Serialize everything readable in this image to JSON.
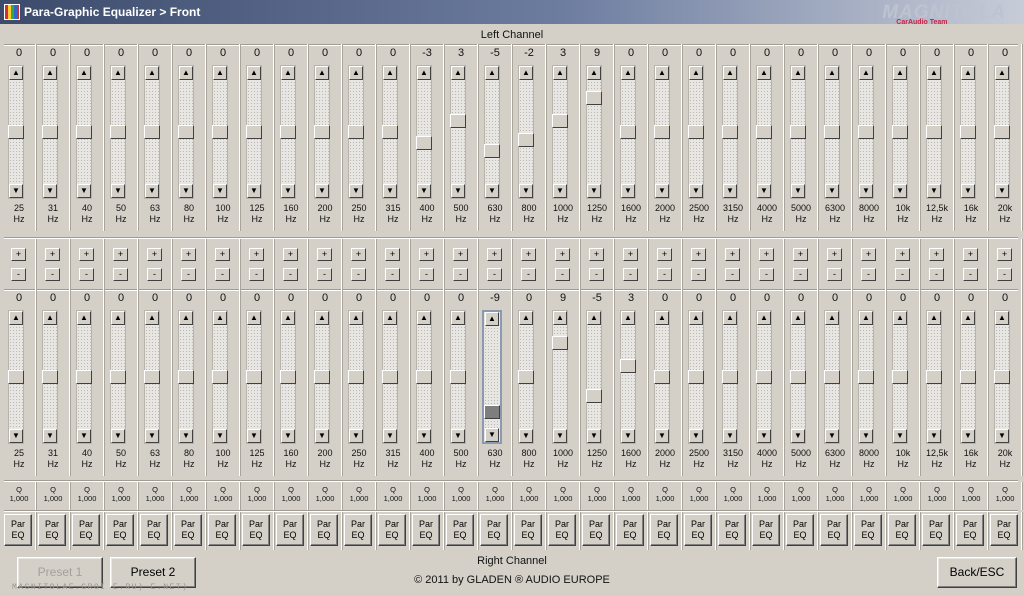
{
  "window": {
    "title": "Para-Graphic Equalizer > Front",
    "icon": "equalizer-app-icon"
  },
  "logo": {
    "main": "MAGNITOLA",
    "sub": "CarAudio Team"
  },
  "left_channel": {
    "label": "Left Channel",
    "bands": [
      {
        "value": "0",
        "freq": "25",
        "unit": "Hz"
      },
      {
        "value": "0",
        "freq": "31",
        "unit": "Hz"
      },
      {
        "value": "0",
        "freq": "40",
        "unit": "Hz"
      },
      {
        "value": "0",
        "freq": "50",
        "unit": "Hz"
      },
      {
        "value": "0",
        "freq": "63",
        "unit": "Hz"
      },
      {
        "value": "0",
        "freq": "80",
        "unit": "Hz"
      },
      {
        "value": "0",
        "freq": "100",
        "unit": "Hz"
      },
      {
        "value": "0",
        "freq": "125",
        "unit": "Hz"
      },
      {
        "value": "0",
        "freq": "160",
        "unit": "Hz"
      },
      {
        "value": "0",
        "freq": "200",
        "unit": "Hz"
      },
      {
        "value": "0",
        "freq": "250",
        "unit": "Hz"
      },
      {
        "value": "0",
        "freq": "315",
        "unit": "Hz"
      },
      {
        "value": "-3",
        "freq": "400",
        "unit": "Hz"
      },
      {
        "value": "3",
        "freq": "500",
        "unit": "Hz"
      },
      {
        "value": "-5",
        "freq": "630",
        "unit": "Hz"
      },
      {
        "value": "-2",
        "freq": "800",
        "unit": "Hz"
      },
      {
        "value": "3",
        "freq": "1000",
        "unit": "Hz"
      },
      {
        "value": "9",
        "freq": "1250",
        "unit": "Hz"
      },
      {
        "value": "0",
        "freq": "1600",
        "unit": "Hz"
      },
      {
        "value": "0",
        "freq": "2000",
        "unit": "Hz"
      },
      {
        "value": "0",
        "freq": "2500",
        "unit": "Hz"
      },
      {
        "value": "0",
        "freq": "3150",
        "unit": "Hz"
      },
      {
        "value": "0",
        "freq": "4000",
        "unit": "Hz"
      },
      {
        "value": "0",
        "freq": "5000",
        "unit": "Hz"
      },
      {
        "value": "0",
        "freq": "6300",
        "unit": "Hz"
      },
      {
        "value": "0",
        "freq": "8000",
        "unit": "Hz"
      },
      {
        "value": "0",
        "freq": "10k",
        "unit": "Hz"
      },
      {
        "value": "0",
        "freq": "12,5k",
        "unit": "Hz"
      },
      {
        "value": "0",
        "freq": "16k",
        "unit": "Hz"
      },
      {
        "value": "0",
        "freq": "20k",
        "unit": "Hz"
      }
    ]
  },
  "right_channel": {
    "label": "Right Channel",
    "focused_band": 14,
    "bands": [
      {
        "value": "0",
        "freq": "25",
        "unit": "Hz",
        "q_label": "Q",
        "q": "1,000"
      },
      {
        "value": "0",
        "freq": "31",
        "unit": "Hz",
        "q_label": "Q",
        "q": "1,000"
      },
      {
        "value": "0",
        "freq": "40",
        "unit": "Hz",
        "q_label": "Q",
        "q": "1,000"
      },
      {
        "value": "0",
        "freq": "50",
        "unit": "Hz",
        "q_label": "Q",
        "q": "1,000"
      },
      {
        "value": "0",
        "freq": "63",
        "unit": "Hz",
        "q_label": "Q",
        "q": "1,000"
      },
      {
        "value": "0",
        "freq": "80",
        "unit": "Hz",
        "q_label": "Q",
        "q": "1,000"
      },
      {
        "value": "0",
        "freq": "100",
        "unit": "Hz",
        "q_label": "Q",
        "q": "1,000"
      },
      {
        "value": "0",
        "freq": "125",
        "unit": "Hz",
        "q_label": "Q",
        "q": "1,000"
      },
      {
        "value": "0",
        "freq": "160",
        "unit": "Hz",
        "q_label": "Q",
        "q": "1,000"
      },
      {
        "value": "0",
        "freq": "200",
        "unit": "Hz",
        "q_label": "Q",
        "q": "1,000"
      },
      {
        "value": "0",
        "freq": "250",
        "unit": "Hz",
        "q_label": "Q",
        "q": "1,000"
      },
      {
        "value": "0",
        "freq": "315",
        "unit": "Hz",
        "q_label": "Q",
        "q": "1,000"
      },
      {
        "value": "0",
        "freq": "400",
        "unit": "Hz",
        "q_label": "Q",
        "q": "1,000"
      },
      {
        "value": "0",
        "freq": "500",
        "unit": "Hz",
        "q_label": "Q",
        "q": "1,000"
      },
      {
        "value": "-9",
        "freq": "630",
        "unit": "Hz",
        "q_label": "Q",
        "q": "1,000"
      },
      {
        "value": "0",
        "freq": "800",
        "unit": "Hz",
        "q_label": "Q",
        "q": "1,000"
      },
      {
        "value": "9",
        "freq": "1000",
        "unit": "Hz",
        "q_label": "Q",
        "q": "1,000"
      },
      {
        "value": "-5",
        "freq": "1250",
        "unit": "Hz",
        "q_label": "Q",
        "q": "1,000"
      },
      {
        "value": "3",
        "freq": "1600",
        "unit": "Hz",
        "q_label": "Q",
        "q": "1,000"
      },
      {
        "value": "0",
        "freq": "2000",
        "unit": "Hz",
        "q_label": "Q",
        "q": "1,000"
      },
      {
        "value": "0",
        "freq": "2500",
        "unit": "Hz",
        "q_label": "Q",
        "q": "1,000"
      },
      {
        "value": "0",
        "freq": "3150",
        "unit": "Hz",
        "q_label": "Q",
        "q": "1,000"
      },
      {
        "value": "0",
        "freq": "4000",
        "unit": "Hz",
        "q_label": "Q",
        "q": "1,000"
      },
      {
        "value": "0",
        "freq": "5000",
        "unit": "Hz",
        "q_label": "Q",
        "q": "1,000"
      },
      {
        "value": "0",
        "freq": "6300",
        "unit": "Hz",
        "q_label": "Q",
        "q": "1,000"
      },
      {
        "value": "0",
        "freq": "8000",
        "unit": "Hz",
        "q_label": "Q",
        "q": "1,000"
      },
      {
        "value": "0",
        "freq": "10k",
        "unit": "Hz",
        "q_label": "Q",
        "q": "1,000"
      },
      {
        "value": "0",
        "freq": "12,5k",
        "unit": "Hz",
        "q_label": "Q",
        "q": "1,000"
      },
      {
        "value": "0",
        "freq": "16k",
        "unit": "Hz",
        "q_label": "Q",
        "q": "1,000"
      },
      {
        "value": "0",
        "freq": "20k",
        "unit": "Hz",
        "q_label": "Q",
        "q": "1,000"
      }
    ]
  },
  "controls": {
    "plus_label": "+",
    "minus_label": "-",
    "par_eq_line1": "Par",
    "par_eq_line2": "EQ",
    "up_arrow": "▲",
    "down_arrow": "▼"
  },
  "slider_range": {
    "min": -12,
    "max": 12
  },
  "buttons": {
    "preset1": "Preset 1",
    "preset2": "Preset 2",
    "back": "Back/ESC"
  },
  "footer": {
    "copyright": "© 2011 by GLADEN ® AUDIO EUROPE"
  },
  "watermark": "MAGNITOLAE.GROI E.RU) E.NET)",
  "colors": {
    "title_start": "#3c4b6b",
    "title_end": "#c7ccd8",
    "face": "#d4d0c8"
  }
}
